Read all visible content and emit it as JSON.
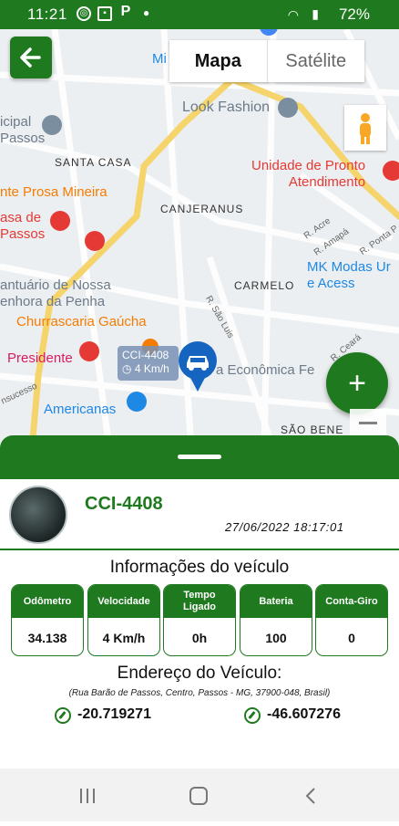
{
  "status_bar": {
    "time": "11:21",
    "icons": [
      "whatsapp-icon",
      "image-icon",
      "parking-icon"
    ],
    "battery": "72%"
  },
  "map": {
    "tabs": [
      {
        "label": "Mapa",
        "selected": true
      },
      {
        "label": "Satélite",
        "selected": false
      }
    ],
    "labels": {
      "m_partial": "Mi",
      "municipal": "icipal\nPassos",
      "santa_casa": "SANTA CASA",
      "look_fashion": "Look Fashion",
      "pronto_atendimento": "Unidade de Pronto\nAtendimento",
      "prosa_mineira": "nte Prosa Mineira",
      "casa_de_passos": "asa de\nPassos",
      "canjeranus": "CANJERANUS",
      "r_acre": "R. Acre",
      "r_amapa": "R. Amapá",
      "r_ponta": "R. Ponta P",
      "santuario": "antuário de Nossa\nenhora da Penha",
      "carmelo": "CARMELO",
      "mk_modas": "MK Modas Ur\ne Acess",
      "churrascaria": "Churrascaria Gaúcha",
      "r_sao_luis": "R. São Luis",
      "presidente": "Presidente",
      "economica": "a Econômica Fe",
      "americanas": "Americanas",
      "sao_bene": "SÃO BENE",
      "r_ceara": "R. Ceará",
      "r_ascenso": "nsucesso"
    },
    "vehicle_marker": {
      "plate": "CCI-4408",
      "speed": "4 Km/h"
    }
  },
  "vehicle": {
    "plate": "CCI-4408",
    "datetime": "27/06/2022 18:17:01",
    "info_title": "Informações do veículo",
    "metrics": [
      {
        "label": "Odômetro",
        "value": "34.138"
      },
      {
        "label": "Velocidade",
        "value": "4 Km/h"
      },
      {
        "label": "Tempo Ligado",
        "value": "0h"
      },
      {
        "label": "Bateria",
        "value": "100"
      },
      {
        "label": "Conta-Giro",
        "value": "0"
      }
    ],
    "address_title": "Endereço do Veículo:",
    "address": "(Rua Barão de Passos, Centro, Passos - MG, 37900-048, Brasil)",
    "latitude": "-20.719271",
    "longitude": "-46.607276"
  },
  "colors": {
    "primary": "#1f7a1f",
    "map_bg": "#eceff1",
    "road": "#fdd663",
    "accent_blue": "#1565c0",
    "poi_red": "#e53935"
  }
}
